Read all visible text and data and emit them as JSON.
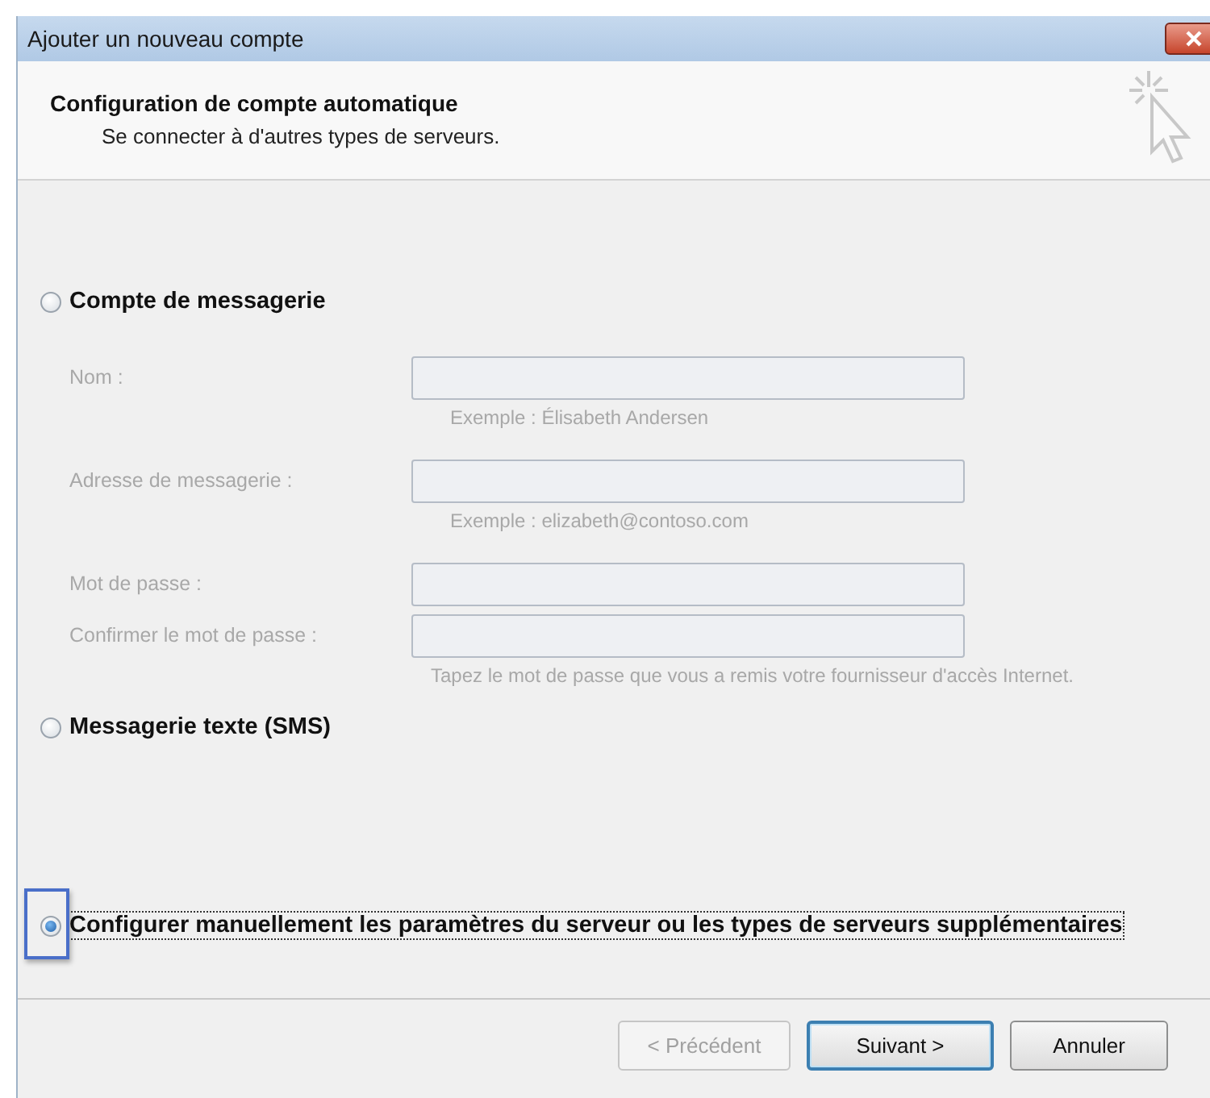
{
  "window": {
    "title": "Ajouter un nouveau compte"
  },
  "header": {
    "title": "Configuration de compte automatique",
    "subtitle": "Se connecter à d'autres types de serveurs."
  },
  "options": [
    {
      "label": "Compte de messagerie",
      "selected": false,
      "focused": false,
      "fields": [
        {
          "label": "Nom :",
          "hint": "Exemple : Élisabeth Andersen",
          "disabled": true
        },
        {
          "label": "Adresse de messagerie :",
          "hint": "Exemple : elizabeth@contoso.com",
          "disabled": true
        },
        {
          "label": "Mot de passe :",
          "disabled": true
        },
        {
          "label": "Confirmer le mot de passe :",
          "hint": "Tapez le mot de passe que vous a remis votre fournisseur d'accès Internet.",
          "disabled": true
        }
      ]
    },
    {
      "label": "Messagerie texte (SMS)",
      "selected": false,
      "focused": false
    },
    {
      "label": "Configurer manuellement les paramètres du serveur ou les types de serveurs supplémentaires",
      "selected": true,
      "focused": true
    }
  ],
  "buttons": [
    {
      "label": "< Précédent",
      "disabled": true,
      "default": false
    },
    {
      "label": "Suivant >",
      "disabled": false,
      "default": true
    },
    {
      "label": "Annuler",
      "disabled": false,
      "default": false
    }
  ]
}
